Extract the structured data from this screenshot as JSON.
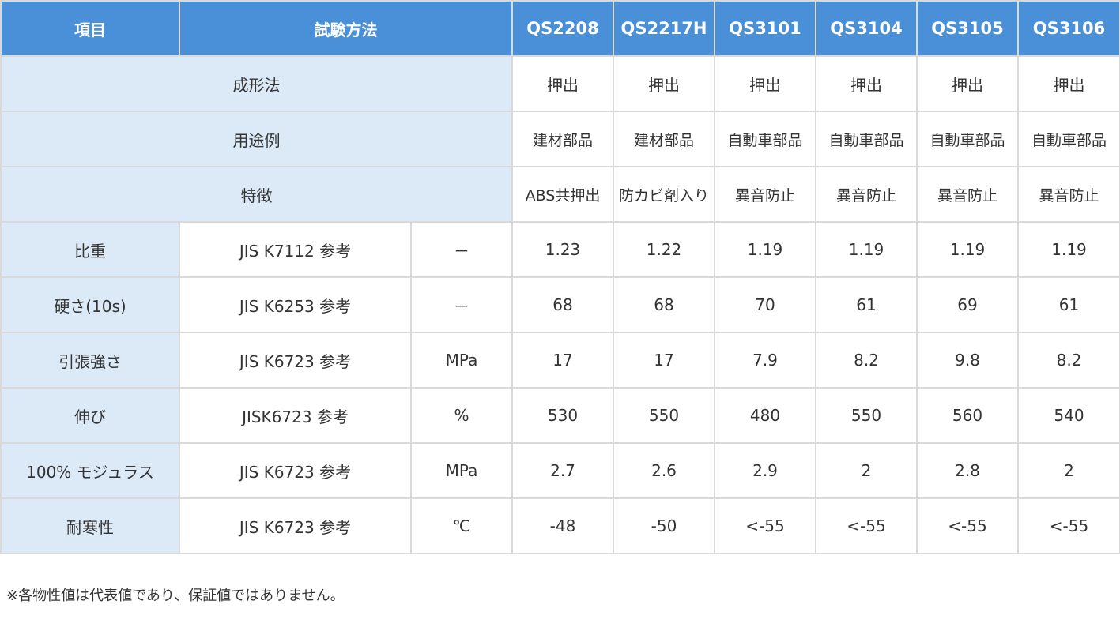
{
  "header": {
    "item": "項目",
    "method": "試験方法",
    "models": [
      "QS2208",
      "QS2217H",
      "QS3101",
      "QS3104",
      "QS3105",
      "QS3106"
    ]
  },
  "info_rows": [
    {
      "label": "成形法",
      "values": [
        "押出",
        "押出",
        "押出",
        "押出",
        "押出",
        "押出"
      ]
    },
    {
      "label": "用途例",
      "values": [
        "建材部品",
        "建材部品",
        "自動車部品",
        "自動車部品",
        "自動車部品",
        "自動車部品"
      ]
    },
    {
      "label": "特徴",
      "values": [
        "ABS共押出",
        "防カビ剤入り",
        "異音防止",
        "異音防止",
        "異音防止",
        "異音防止"
      ]
    }
  ],
  "property_rows": [
    {
      "label": "比重",
      "method": "JIS K7112 参考",
      "unit": "－",
      "values": [
        "1.23",
        "1.22",
        "1.19",
        "1.19",
        "1.19",
        "1.19"
      ]
    },
    {
      "label": "硬さ(10s)",
      "method": "JIS K6253 参考",
      "unit": "－",
      "values": [
        "68",
        "68",
        "70",
        "61",
        "69",
        "61"
      ]
    },
    {
      "label": "引張強さ",
      "method": "JIS K6723 参考",
      "unit": "MPa",
      "values": [
        "17",
        "17",
        "7.9",
        "8.2",
        "9.8",
        "8.2"
      ]
    },
    {
      "label": "伸び",
      "method": "JISK6723 参考",
      "unit": "%",
      "values": [
        "530",
        "550",
        "480",
        "550",
        "560",
        "540"
      ]
    },
    {
      "label": "100% モジュラス",
      "method": "JIS K6723 参考",
      "unit": "MPa",
      "values": [
        "2.7",
        "2.6",
        "2.9",
        "2",
        "2.8",
        "2"
      ]
    },
    {
      "label": "耐寒性",
      "method": "JIS K6723 参考",
      "unit": "℃",
      "values": [
        "-48",
        "-50",
        "<-55",
        "<-55",
        "<-55",
        "<-55"
      ]
    }
  ],
  "footnote": "※各物性値は代表値であり、保証値ではありません。",
  "colors": {
    "header": "#4a90d9",
    "label_bg": "#dce9f7",
    "border": "#d9d9d9"
  }
}
